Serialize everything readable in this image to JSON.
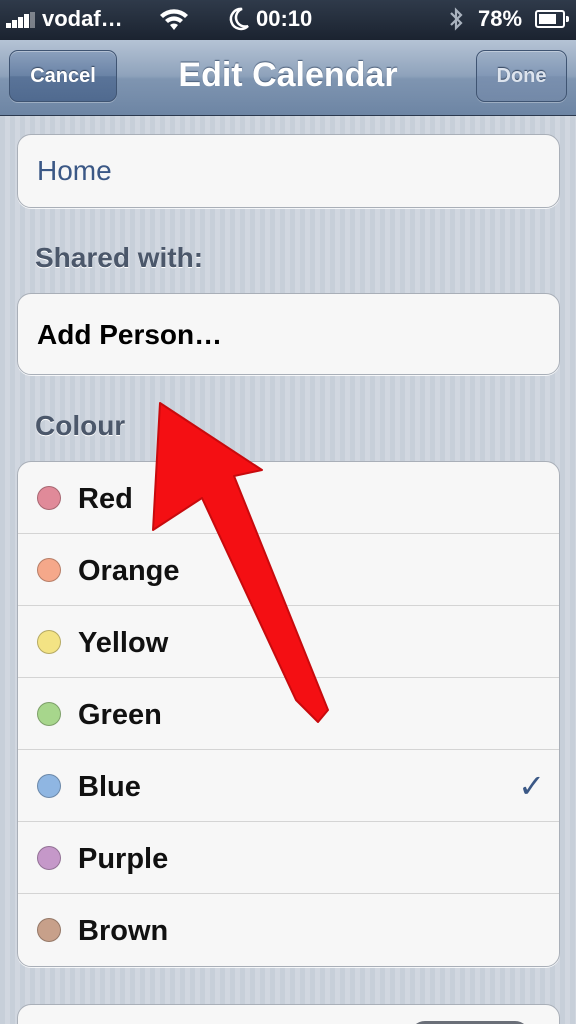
{
  "status_bar": {
    "carrier": "vodaf…",
    "time": "00:10",
    "battery": "78%",
    "battery_level": 0.78,
    "icons": [
      "signal-icon",
      "wifi-icon",
      "moon-icon",
      "bluetooth-icon",
      "battery-icon"
    ]
  },
  "nav": {
    "title": "Edit Calendar",
    "cancel_label": "Cancel",
    "done_label": "Done"
  },
  "calendar": {
    "name": "Home"
  },
  "shared": {
    "header": "Shared with:",
    "add_person": "Add Person…"
  },
  "colour": {
    "header": "Colour",
    "selected": "Blue",
    "options": [
      {
        "label": "Red",
        "color": "#e08a99"
      },
      {
        "label": "Orange",
        "color": "#f5a88a"
      },
      {
        "label": "Yellow",
        "color": "#f3e384"
      },
      {
        "label": "Green",
        "color": "#a7d68c"
      },
      {
        "label": "Blue",
        "color": "#8fb6e2"
      },
      {
        "label": "Purple",
        "color": "#c598c9"
      },
      {
        "label": "Brown",
        "color": "#c7a08a"
      }
    ]
  },
  "annotation": {
    "arrow_color": "#f40f13"
  }
}
